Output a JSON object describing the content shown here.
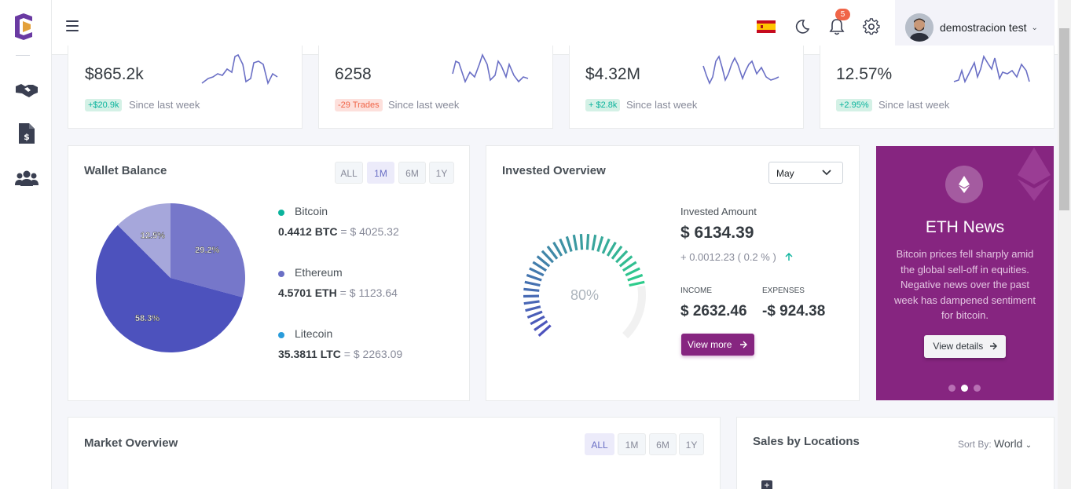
{
  "topbar": {
    "notification_count": "5",
    "user_name": "demostracion test"
  },
  "stats": [
    {
      "value": "$865.2k",
      "change": "+$20.9k",
      "change_type": "up",
      "since": "Since last week"
    },
    {
      "value": "6258",
      "change": "-29 Trades",
      "change_type": "down",
      "since": "Since last week"
    },
    {
      "value": "$4.32M",
      "change": "+ $2.8k",
      "change_type": "up",
      "since": "Since last week"
    },
    {
      "value": "12.57%",
      "change": "+2.95%",
      "change_type": "up",
      "since": "Since last week"
    }
  ],
  "wallet": {
    "title": "Wallet Balance",
    "ranges": [
      "ALL",
      "1M",
      "6M",
      "1Y"
    ],
    "active_range": "1M",
    "coins": [
      {
        "name": "Bitcoin",
        "amount": "0.4412 BTC",
        "usd": "$ 4025.32",
        "color": "#0ab39c"
      },
      {
        "name": "Ethereum",
        "amount": "4.5701 ETH",
        "usd": "$ 1123.64",
        "color": "#6a6fc5"
      },
      {
        "name": "Litecoin",
        "amount": "35.3811 LTC",
        "usd": "$ 2263.09",
        "color": "#299cdb"
      }
    ]
  },
  "chart_data": {
    "type": "pie",
    "categories": [
      "Pie slice 1",
      "Pie slice 2",
      "Pie slice 3"
    ],
    "values": [
      29.2,
      58.3,
      12.5
    ],
    "labels": [
      "29.2%",
      "58.3%",
      "12.5%"
    ],
    "colors": [
      "#7677ca",
      "#4d52bd",
      "#a6a7db"
    ]
  },
  "invested": {
    "title": "Invested Overview",
    "month": "May",
    "gauge_value": "80%",
    "gauge_level": 0.8,
    "amount_label": "Invested Amount",
    "amount": "$ 6134.39",
    "change": "+ 0.0012.23 ( 0.2 % )",
    "income_label": "INCOME",
    "income": "$ 2632.46",
    "expenses_label": "EXPENSES",
    "expenses": "-$ 924.38",
    "button": "View more"
  },
  "eth_news": {
    "title": "ETH News",
    "text": "Bitcoin prices fell sharply amid the global sell-off in equities. Negative news over the past week has dampened sentiment for bitcoin.",
    "button": "View details"
  },
  "market": {
    "title": "Market Overview",
    "ranges": [
      "ALL",
      "1M",
      "6M",
      "1Y"
    ],
    "active_range": "ALL"
  },
  "sales": {
    "title": "Sales by Locations",
    "sort_label": "Sort By:",
    "sort_value": "World"
  },
  "colors": {
    "accent": "#6a6fc5",
    "eth_bg": "#862580",
    "success": "#0ab39c",
    "danger": "#f06548"
  }
}
